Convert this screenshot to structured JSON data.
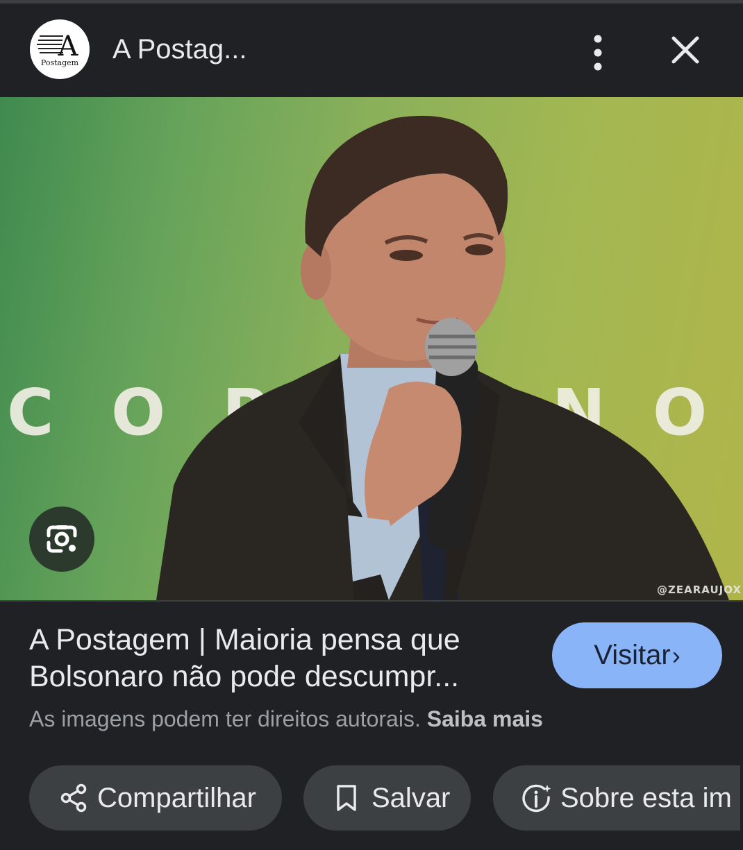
{
  "header": {
    "logo": {
      "letter": "A",
      "text": "Postagem"
    },
    "site_title": "A Postag...",
    "more_icon": "more-vert-icon",
    "close_icon": "close-icon"
  },
  "image": {
    "background_letters": [
      "C",
      "O",
      "R",
      "N",
      "O"
    ],
    "watermark": "@ZEARAUJOX",
    "lens_icon": "google-lens-icon"
  },
  "info": {
    "headline_line1": "A Postagem | Maioria pensa que",
    "headline_line2": "Bolsonaro não pode descumpr...",
    "visit_label": "Visitar",
    "visit_chevron": "›",
    "copyright_text": "As imagens podem ter direitos autorais.",
    "learn_more": "Saiba mais"
  },
  "actions": [
    {
      "label": "Compartilhar",
      "icon": "share-icon"
    },
    {
      "label": "Salvar",
      "icon": "bookmark-icon"
    },
    {
      "label": "Sobre esta im",
      "icon": "about-info-icon"
    }
  ],
  "colors": {
    "background": "#202124",
    "visit_button": "#8ab4f8",
    "chip_background": "#3c4043"
  }
}
